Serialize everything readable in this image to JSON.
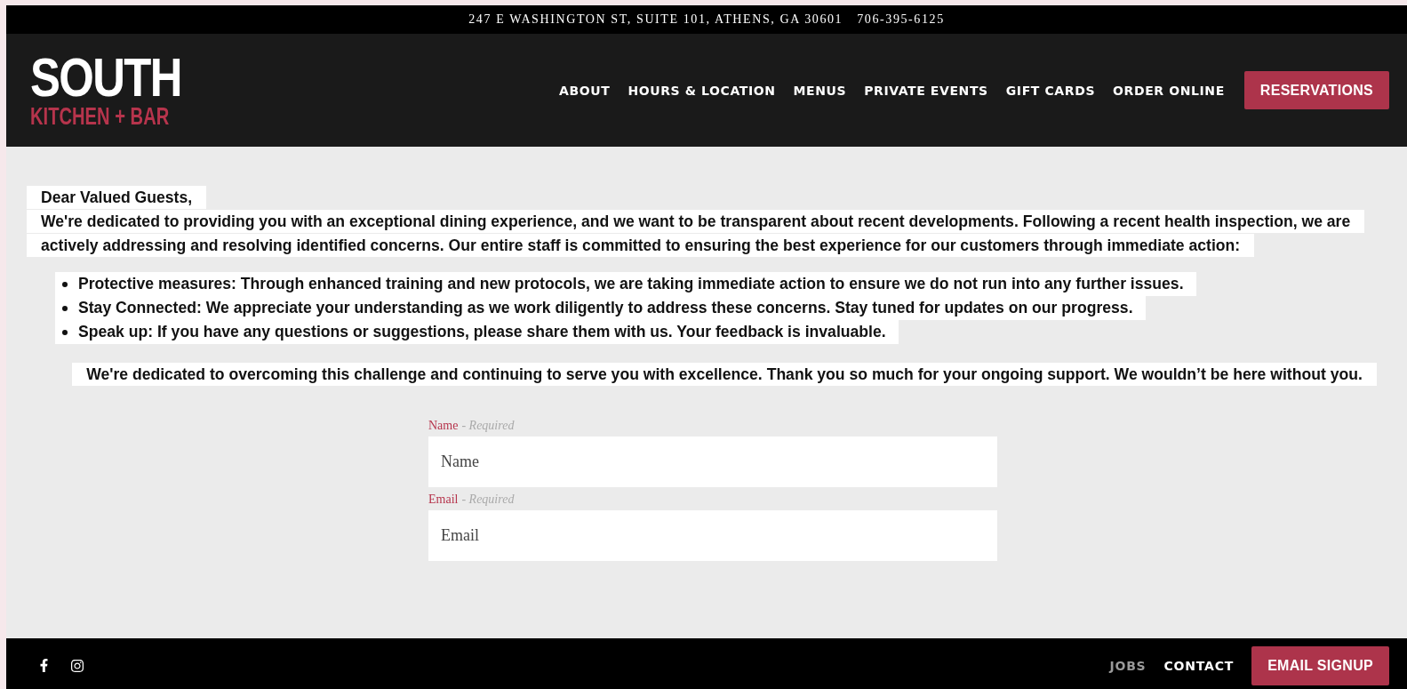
{
  "top_bar": {
    "address": "247 E WASHINGTON ST, SUITE 101, ATHENS, GA 30601",
    "phone": "706-395-6125"
  },
  "logo": {
    "title": "SOUTH",
    "subtitle": "KITCHEN + BAR"
  },
  "nav": {
    "items": [
      "ABOUT",
      "HOURS & LOCATION",
      "MENUS",
      "PRIVATE EVENTS",
      "GIFT CARDS",
      "ORDER ONLINE"
    ],
    "cta": "RESERVATIONS"
  },
  "notice": {
    "greeting": "Dear Valued Guests,",
    "intro": "We're dedicated to providing you with an exceptional dining experience, and we want to be transparent about recent developments. Following a recent health inspection, we are actively addressing and resolving identified concerns. Our entire staff is committed to ensuring the best experience for our customers through immediate action:",
    "bullets": [
      "Protective measures: Through enhanced training and new protocols, we are taking immediate action to ensure we do not run into any further issues.",
      "Stay Connected: We appreciate your understanding as we work diligently to address these concerns. Stay tuned for updates on our progress.",
      "Speak up: If you have any questions or suggestions, please share them with us. Your feedback is invaluable."
    ],
    "closing": "We're dedicated to overcoming this challenge and continuing to serve you with excellence. Thank you so much for your ongoing support. We wouldn’t be here without you."
  },
  "form": {
    "fields": [
      {
        "label": "Name",
        "note": "- Required",
        "placeholder": "Name"
      },
      {
        "label": "Email",
        "note": "- Required",
        "placeholder": "Email"
      }
    ]
  },
  "footer": {
    "links": [
      {
        "label": "JOBS",
        "selected": true
      },
      {
        "label": "CONTACT",
        "selected": false
      }
    ],
    "cta": "EMAIL SIGNUP"
  }
}
